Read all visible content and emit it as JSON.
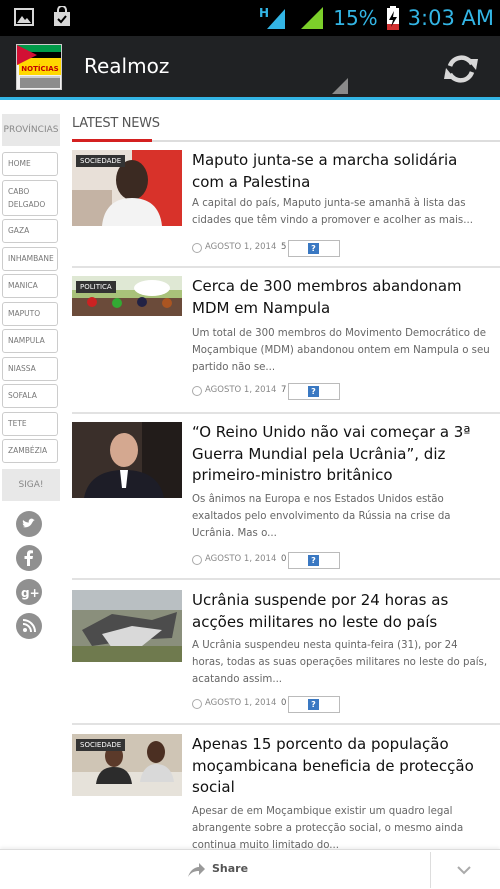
{
  "status_bar": {
    "network": "H",
    "battery_percent": "15%",
    "time": "3:03 AM",
    "accent_color": "#33b5e5"
  },
  "action_bar": {
    "logo_text": "NOTÍCIAS",
    "title": "Realmoz",
    "refresh_icon": "refresh-icon"
  },
  "sidebar": {
    "header": "PROVÍNCIAS",
    "provinces": [
      "HOME",
      "CABO DELGADO",
      "GAZA",
      "INHAMBANE",
      "MANICA",
      "MAPUTO",
      "NAMPULA",
      "NIASSA",
      "SOFALA",
      "TETE",
      "ZAMBÉZIA"
    ],
    "follow_header": "SIGA!",
    "social": [
      "twitter-icon",
      "facebook-icon",
      "google-plus-icon",
      "rss-icon"
    ]
  },
  "main": {
    "section_title": "LATEST NEWS",
    "accent_color": "#d42020",
    "articles": [
      {
        "category": "SOCIEDADE",
        "title": "Maputo junta-se a marcha solidária com a Palestina",
        "excerpt": "A capital do país, Maputo junta-se amanhã à lista das cidades que têm vindo a promover e acolher as mais...",
        "date": "AGOSTO 1, 2014",
        "comments": "5"
      },
      {
        "category": "POLITICA",
        "title": "Cerca de 300 membros abandonam MDM em Nampula",
        "excerpt": "Um total de 300 membros do Movimento Democrático de Moçambique (MDM) abandonou ontem em Nampula o seu partido não se...",
        "date": "AGOSTO 1, 2014",
        "comments": "7"
      },
      {
        "category": "",
        "title": "“O Reino Unido não vai começar a 3ª Guerra Mundial pela Ucrânia”, diz primeiro-ministro britânico",
        "excerpt": "Os ânimos na Europa e nos Estados Unidos estão exaltados pelo envolvimento da Rússia na crise da Ucrânia. Mas o...",
        "date": "AGOSTO 1, 2014",
        "comments": "0"
      },
      {
        "category": "",
        "title": "Ucrânia suspende por 24 horas as acções militares no leste do país",
        "excerpt": "A Ucrânia suspendeu nesta quinta-feira (31), por 24 horas, todas as suas operações militares no leste do país, acatando assim...",
        "date": "AGOSTO 1, 2014",
        "comments": "0"
      },
      {
        "category": "SOCIEDADE",
        "title": "Apenas 15 porcento da população moçambicana beneficia de protecção social",
        "excerpt": "Apesar de em Moçambique existir um quadro legal abrangente sobre a protecção social, o mesmo ainda continua muito limitado do...",
        "date": "",
        "comments": ""
      }
    ]
  },
  "bottom_bar": {
    "share_label": "Share",
    "expand_icon": "chevron-down-icon"
  }
}
